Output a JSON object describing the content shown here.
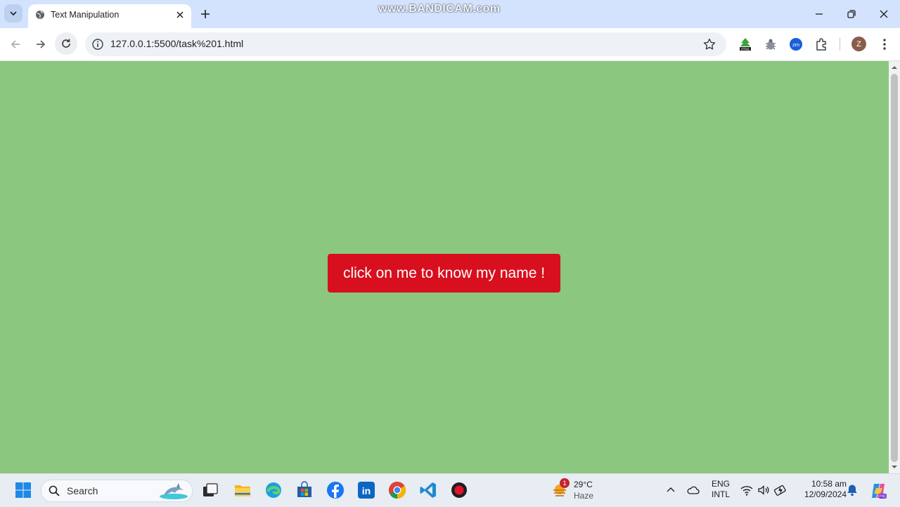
{
  "browser": {
    "tab": {
      "title": "Text Manipulation"
    },
    "watermark": "www.BANDICAM.com",
    "address": {
      "url": "127.0.0.1:5500/task%201.html"
    },
    "profile_initial": "Z",
    "extensions": [
      "html-extension-icon",
      "bug-extension-icon",
      "zoom-extension-icon",
      "puzzle-extensions-icon"
    ]
  },
  "page": {
    "background_color": "#8bc77f",
    "button": {
      "label": "click on me to know my name !",
      "color": "#d80f1e"
    }
  },
  "taskbar": {
    "search_placeholder": "Search",
    "weather": {
      "badge": "1",
      "temperature": "29°C",
      "condition": "Haze"
    },
    "language": {
      "line1": "ENG",
      "line2": "INTL"
    },
    "clock": {
      "time": "10:58 am",
      "date": "12/09/2024"
    },
    "pinned": [
      "file-explorer-icon",
      "edge-icon",
      "store-icon",
      "facebook-icon",
      "linkedin-icon",
      "chrome-icon",
      "vscode-icon",
      "record-icon"
    ]
  }
}
